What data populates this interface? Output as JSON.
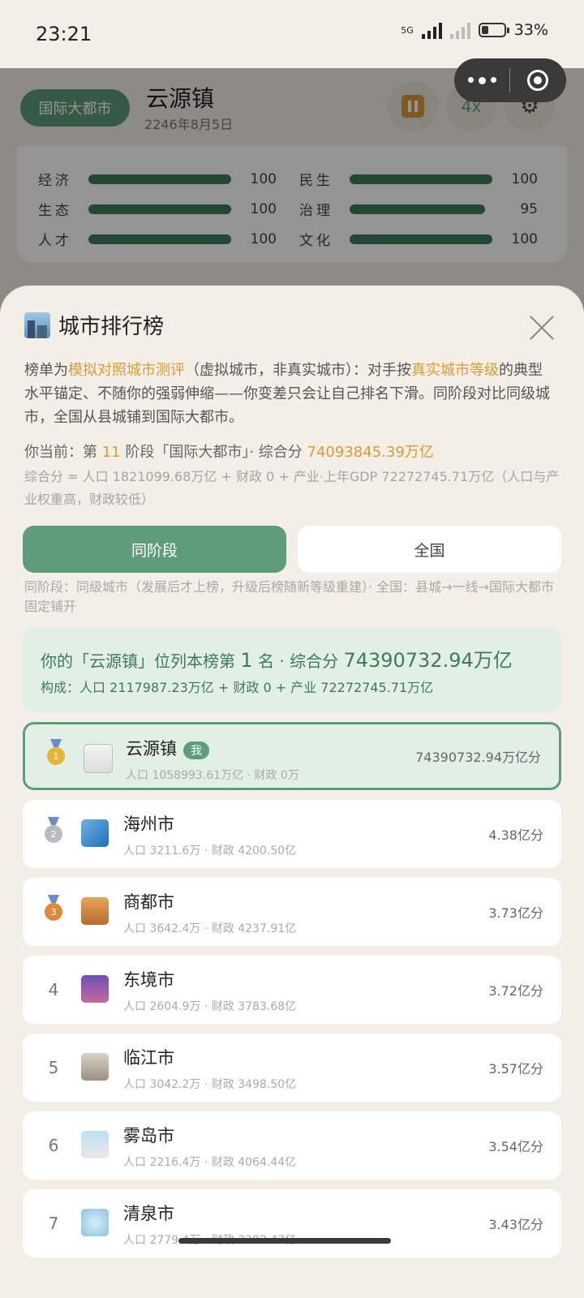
{
  "status_bar": {
    "time": "23:21",
    "network": "5G",
    "battery": "33%",
    "battery_fraction": 0.33
  },
  "game_header": {
    "tier_badge": "国际大都市",
    "town_name": "云源镇",
    "date": "2246年8月5日",
    "speed_label": "4x",
    "icons": [
      "pause-icon",
      "gear-icon"
    ]
  },
  "metrics": [
    {
      "label": "经济",
      "value": "100",
      "fraction": 1.0
    },
    {
      "label": "民生",
      "value": "100",
      "fraction": 1.0
    },
    {
      "label": "生态",
      "value": "100",
      "fraction": 1.0
    },
    {
      "label": "治理",
      "value": "95",
      "fraction": 0.95
    },
    {
      "label": "人才",
      "value": "100",
      "fraction": 1.0
    },
    {
      "label": "文化",
      "value": "100",
      "fraction": 1.0
    }
  ],
  "sheet": {
    "title": "城市排行榜",
    "title_icon": "cityscape-icon",
    "desc": {
      "p1": "榜单为",
      "h1": "模拟对照城市测评",
      "p2": "（虚拟城市，非真实城市）：对手按",
      "h2": "真实城市等级",
      "p3": "的典型水平锚定、不随你的强弱伸缩——你变差只会让自己排名下滑。同阶段对比同级城市，全国从县城铺到国际大都市。"
    },
    "current": {
      "p1": "你当前：第 ",
      "stage": "11",
      "p2": " 阶段「国际大都市」· 综合分 ",
      "score": "74093845.39万亿"
    },
    "formula": "综合分 = 人口 1821099.68万亿 + 财政 0 + 产业·上年GDP 72272745.71万亿（人口与产业权重高，财政较低）",
    "tabs": {
      "same_stage": "同阶段",
      "national": "全国"
    },
    "tab_note": "同阶段：同级城市（发展后才上榜，升级后榜随新等级重建）· 全国：县城→一线→国际大都市固定铺开",
    "my_summary": {
      "line1_a": "你的「云源镇」位列本榜第 ",
      "rank": "1",
      "line1_b": " 名 · 综合分 ",
      "score": "74390732.94万亿",
      "line2": "构成：人口 2117987.23万亿 + 财政 0 + 产业 72272745.71万亿"
    },
    "ranking": [
      {
        "rank": "1",
        "medal": "gold",
        "icon": "white-flag-icon",
        "name": "云源镇",
        "me_tag": "我",
        "sub": "人口 1058993.61万亿 · 财政 0万",
        "score": "74390732.94万亿分"
      },
      {
        "rank": "2",
        "medal": "silver",
        "icon": "wave-icon",
        "name": "海州市",
        "sub": "人口 3211.6万 · 财政 4200.50亿",
        "score": "4.38亿分"
      },
      {
        "rank": "3",
        "medal": "bronze",
        "icon": "office-building-icon",
        "name": "商都市",
        "sub": "人口 3642.4万 · 财政 4237.91亿",
        "score": "3.73亿分"
      },
      {
        "rank": "4",
        "icon": "night-city-icon",
        "name": "东境市",
        "sub": "人口 2604.9万 · 财政 3783.68亿",
        "score": "3.72亿分"
      },
      {
        "rank": "5",
        "icon": "castle-icon",
        "name": "临江市",
        "sub": "人口 3042.2万 · 财政 3498.50亿",
        "score": "3.57亿分"
      },
      {
        "rank": "6",
        "icon": "foggy-bridge-icon",
        "name": "雾岛市",
        "sub": "人口 2216.4万 · 财政 4064.44亿",
        "score": "3.54亿分"
      },
      {
        "rank": "7",
        "icon": "fountain-icon",
        "name": "清泉市",
        "sub": "人口 2779.4万 · 财政 3282.47亿",
        "score": "3.43亿分"
      }
    ]
  }
}
